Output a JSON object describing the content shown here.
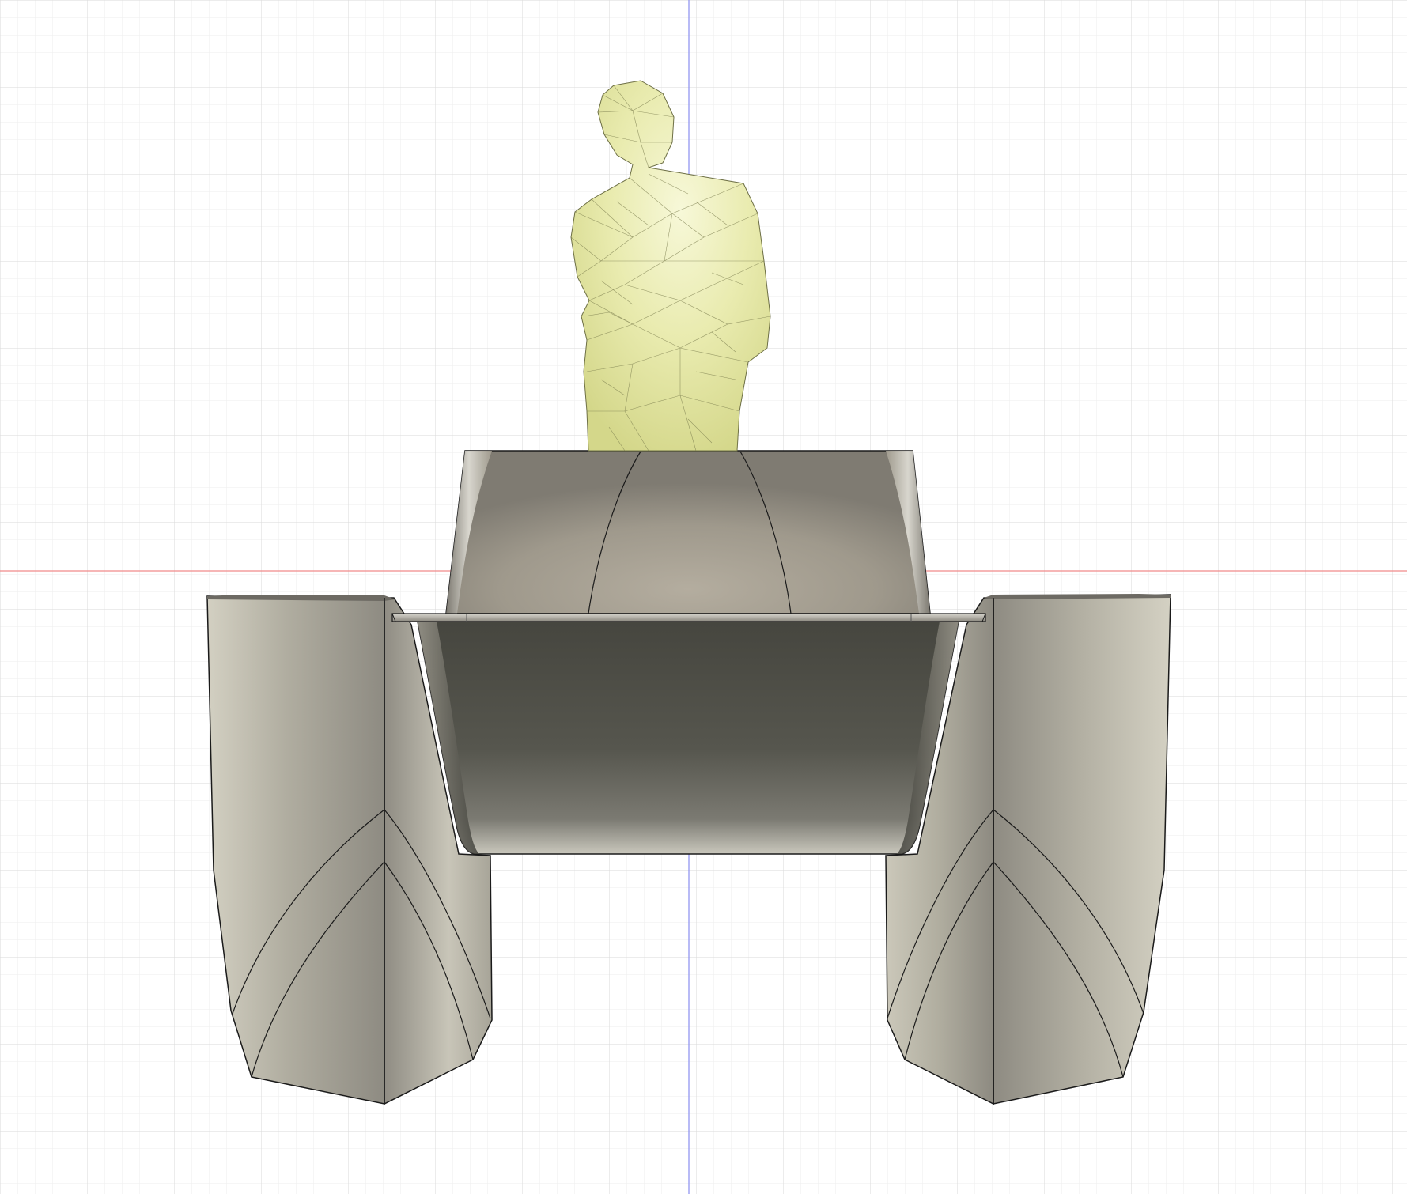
{
  "app": {
    "view": "front",
    "visual_style": "shaded-with-visible-edges"
  },
  "canvas": {
    "background_color": "#ffffff",
    "grid": {
      "visible": true,
      "minor_color": "#eeeeee",
      "major_color": "#d6d6d6"
    },
    "axes": {
      "visible": true,
      "horizontal_axis_color": "#f08a8a",
      "vertical_axis_color": "#8a8ef0"
    }
  },
  "scene": {
    "bodies": [
      {
        "name": "mannequin",
        "color": "#e6e8a8",
        "mesh_visible": true
      },
      {
        "name": "hull-left",
        "color": "#b9b6aa"
      },
      {
        "name": "hull-right",
        "color": "#b9b6aa"
      },
      {
        "name": "cabin-top",
        "color": "#a39d90"
      },
      {
        "name": "center-tunnel",
        "color": "#585852"
      },
      {
        "name": "deck-plate",
        "color": "#9a968c"
      }
    ]
  }
}
